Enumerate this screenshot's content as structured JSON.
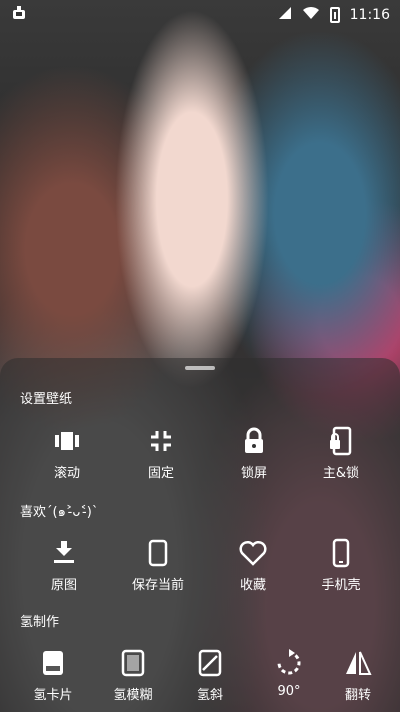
{
  "status_bar": {
    "left_icon": "app-bug-icon",
    "time": "11:16",
    "icons": [
      "signal-icon",
      "wifi-icon",
      "battery-charging-icon"
    ]
  },
  "sections": [
    {
      "title": "设置壁纸",
      "items": [
        {
          "label": "滚动",
          "icon": "scroll-icon"
        },
        {
          "label": "固定",
          "icon": "fixed-icon"
        },
        {
          "label": "锁屏",
          "icon": "lock-icon"
        },
        {
          "label": "主&锁",
          "icon": "home-lock-icon"
        }
      ]
    },
    {
      "title": "喜欢ˊ(๑˃̵ᴗ˂̵)ˋ",
      "items": [
        {
          "label": "原图",
          "icon": "download-icon"
        },
        {
          "label": "保存当前",
          "icon": "save-current-icon"
        },
        {
          "label": "收藏",
          "icon": "heart-icon"
        },
        {
          "label": "手机壳",
          "icon": "phone-case-icon"
        }
      ]
    },
    {
      "title": "氢制作",
      "items": [
        {
          "label": "氢卡片",
          "icon": "card-icon"
        },
        {
          "label": "氢模糊",
          "icon": "blur-icon"
        },
        {
          "label": "氢斜",
          "icon": "tilt-icon"
        },
        {
          "label": "90°",
          "icon": "rotate-icon"
        },
        {
          "label": "翻转",
          "icon": "flip-icon"
        }
      ]
    }
  ]
}
